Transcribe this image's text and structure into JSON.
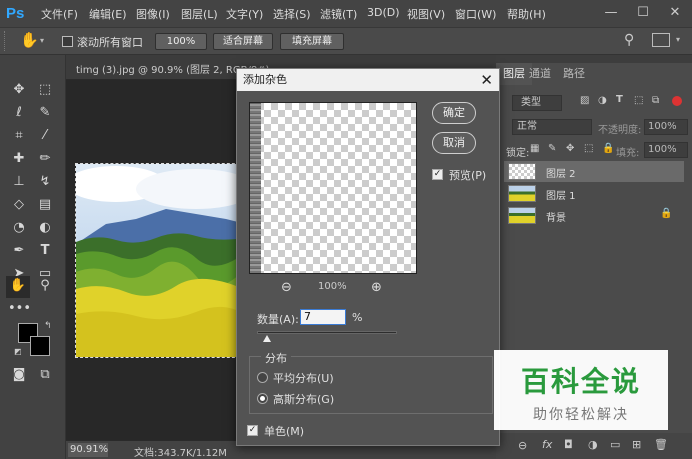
{
  "app": {
    "logo": "Ps"
  },
  "menu": [
    "文件(F)",
    "编辑(E)",
    "图像(I)",
    "图层(L)",
    "文字(Y)",
    "选择(S)",
    "滤镜(T)",
    "3D(D)",
    "视图(V)",
    "窗口(W)",
    "帮助(H)"
  ],
  "window_controls": {
    "minimize": "—",
    "maximize": "☐",
    "close": "✕"
  },
  "options_bar": {
    "scroll_all_label": "滚动所有窗口",
    "zoom_100": "100%",
    "fit_screen": "适合屏幕",
    "fill_screen": "填充屏幕"
  },
  "document": {
    "tab_title": "timg (3).jpg @ 90.9% (图层 2, RGB/8#)",
    "zoom_status": "90.91%",
    "doc_status": "文档:343.7K/1.12M"
  },
  "panel": {
    "tabs": [
      "图层",
      "通道",
      "路径"
    ],
    "kind_label": "类型",
    "blend_mode": "正常",
    "opacity_label": "不透明度:",
    "opacity_value": "100%",
    "lock_label": "锁定:",
    "fill_label": "填充:",
    "fill_value": "100%",
    "layers": [
      {
        "name": "图层 2",
        "selected": true
      },
      {
        "name": "图层 1",
        "selected": false
      },
      {
        "name": "背景",
        "selected": false,
        "locked": true
      }
    ]
  },
  "dialog": {
    "title": "添加杂色",
    "ok_label": "确定",
    "cancel_label": "取消",
    "preview_label": "预览(P)",
    "preview_checked": true,
    "zoom_value": "100%",
    "amount_label": "数量(A):",
    "amount_value": "7",
    "amount_unit": "%",
    "amount_fraction": 0.07,
    "distribution_label": "分布",
    "uniform_label": "平均分布(U)",
    "gaussian_label": "高斯分布(G)",
    "distribution_selected": "gaussian",
    "monochrome_label": "单色(M)",
    "monochrome_checked": true
  },
  "watermark": {
    "title": "百科全说",
    "subtitle": "助你轻松解决"
  },
  "colors": {
    "accent": "#31a8ff",
    "brand_green": "#2a9a3d"
  }
}
